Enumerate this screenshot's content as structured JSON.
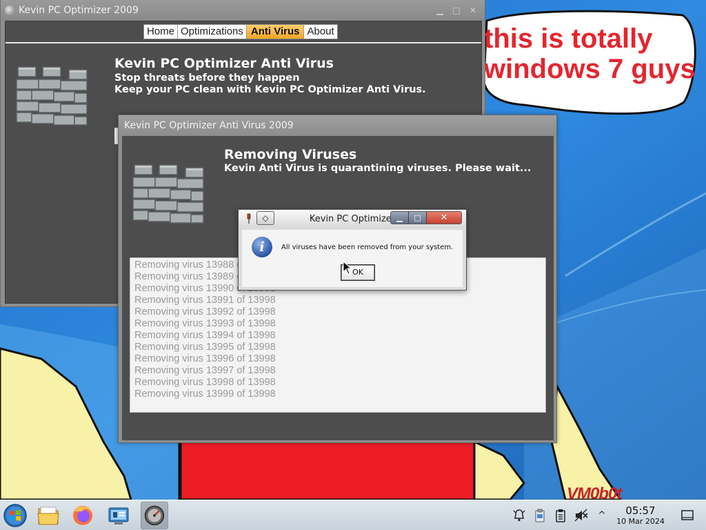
{
  "desktop": {
    "bubble_line1": "this is totally",
    "bubble_line2": "windows 7 guys",
    "signature": "VM0b0t",
    "colors": {
      "sky": "#2a7fd0",
      "bubble_text": "#e3262e",
      "figure": "#f7f0a6",
      "shirt": "#ee1c24"
    }
  },
  "main_window": {
    "title": "Kevin PC Optimizer 2009",
    "tabs": [
      {
        "label": "Home",
        "active": false
      },
      {
        "label": "Optimizations",
        "active": false
      },
      {
        "label": "Anti Virus",
        "active": true
      },
      {
        "label": "About",
        "active": false
      }
    ],
    "heading": "Kevin PC Optimizer Anti Virus",
    "subtitle1": "Stop threats before they happen",
    "subtitle2": "Keep your PC clean with Kevin PC Optimizer Anti Virus.",
    "icon": "firewall-brick-wall-icon"
  },
  "av_window": {
    "title": "Kevin PC Optimizer Anti Virus 2009",
    "heading": "Removing Viruses",
    "subtitle": "Kevin Anti Virus is quarantining viruses. Please wait...",
    "log": [
      "Removing virus 13988 of 13998",
      "Removing virus 13989 of 13998",
      "Removing virus 13990 of 13998",
      "Removing virus 13991 of 13998",
      "Removing virus 13992 of 13998",
      "Removing virus 13993 of 13998",
      "Removing virus 13994 of 13998",
      "Removing virus 13995 of 13998",
      "Removing virus 13996 of 13998",
      "Removing virus 13997 of 13998",
      "Removing virus 13998 of 13998",
      "Removing virus 13999 of 13998"
    ]
  },
  "dialog": {
    "title": "Kevin PC Optimizer",
    "message": "All viruses have been removed from your system.",
    "ok_label": "OK",
    "icon": "info-icon"
  },
  "taskbar": {
    "items": [
      "start-orb-icon",
      "file-manager-icon",
      "firefox-icon",
      "system-settings-icon",
      "optimizer-app-icon"
    ],
    "tray": [
      "notifications-bell-icon",
      "clipboard-icon",
      "task-manager-icon",
      "volume-muted-icon",
      "show-hidden-icons-chevron"
    ],
    "chevron": "^",
    "time": "05:57",
    "date": "10 Mar 2024"
  }
}
